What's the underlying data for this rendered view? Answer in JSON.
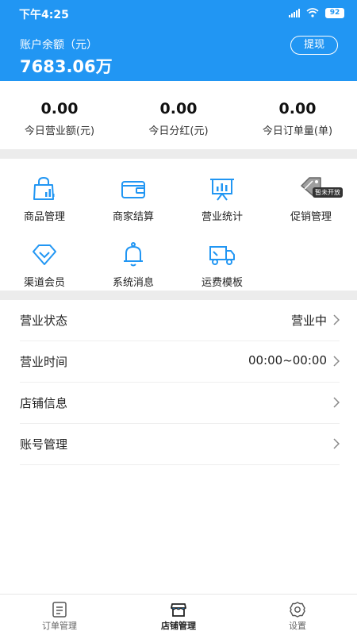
{
  "status_bar": {
    "time": "下午4:25",
    "battery": "92"
  },
  "account": {
    "balance_label": "账户余额（元）",
    "balance_value": "7683.06万",
    "withdraw_label": "提现"
  },
  "stats": [
    {
      "value": "0.00",
      "label": "今日营业额(元)"
    },
    {
      "value": "0.00",
      "label": "今日分红(元)"
    },
    {
      "value": "0.00",
      "label": "今日订单量(单)"
    }
  ],
  "grid": {
    "items": [
      {
        "label": "商品管理",
        "icon": "shopping-bag-chart-icon"
      },
      {
        "label": "商家结算",
        "icon": "wallet-icon"
      },
      {
        "label": "营业统计",
        "icon": "presentation-chart-icon"
      },
      {
        "label": "促销管理",
        "icon": "price-tag-icon",
        "badge": "暂未开放"
      },
      {
        "label": "渠道会员",
        "icon": "diamond-icon"
      },
      {
        "label": "系统消息",
        "icon": "bell-icon"
      },
      {
        "label": "运费模板",
        "icon": "delivery-truck-icon"
      }
    ]
  },
  "list": [
    {
      "label": "营业状态",
      "value": "营业中"
    },
    {
      "label": "营业时间",
      "value": "00:00~00:00"
    },
    {
      "label": "店铺信息",
      "value": ""
    },
    {
      "label": "账号管理",
      "value": ""
    }
  ],
  "bottom_nav": {
    "items": [
      {
        "label": "订单管理",
        "icon": "order-list-icon",
        "active": false
      },
      {
        "label": "店铺管理",
        "icon": "store-icon",
        "active": true
      },
      {
        "label": "设置",
        "icon": "gear-icon",
        "active": false
      }
    ]
  },
  "colors": {
    "primary": "#2196f3",
    "divider": "#ececec"
  }
}
